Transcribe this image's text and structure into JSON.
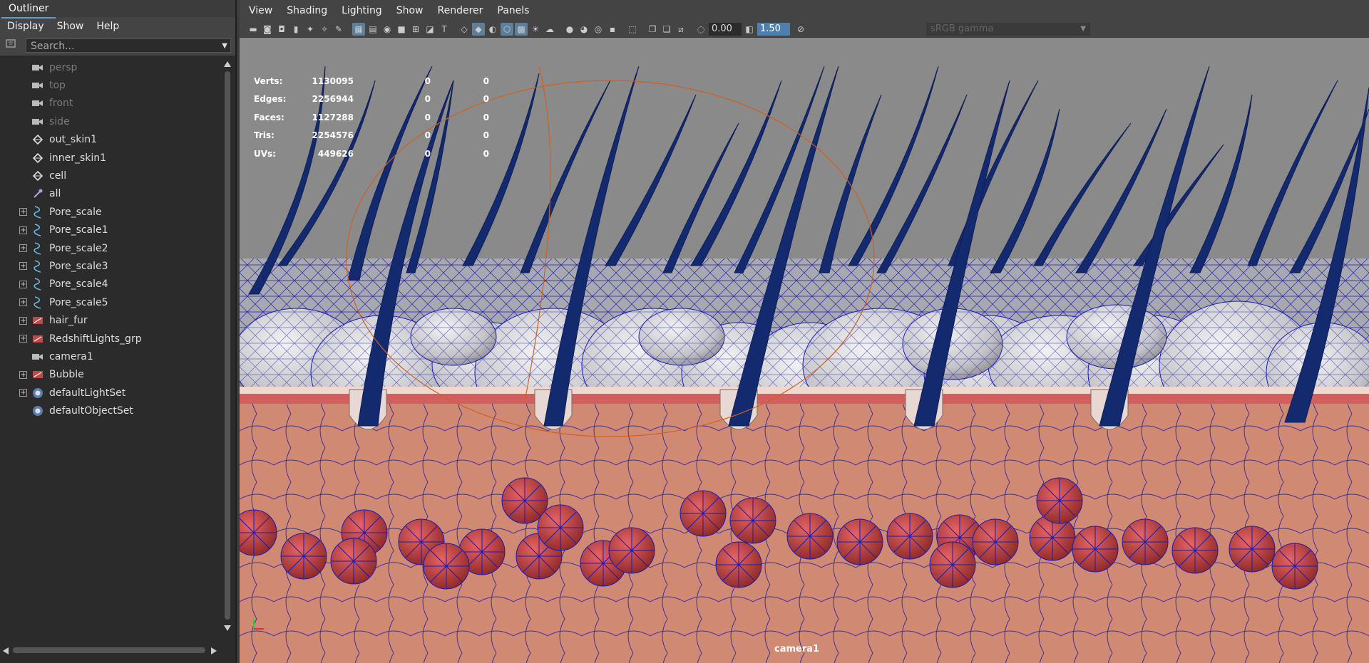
{
  "outliner": {
    "tab_label": "Outliner",
    "menu": [
      "Display",
      "Show",
      "Help"
    ],
    "search_placeholder": "Search...",
    "items": [
      {
        "label": "persp",
        "icon": "camera-icon",
        "dim": true,
        "expand": false
      },
      {
        "label": "top",
        "icon": "camera-icon",
        "dim": true,
        "expand": false
      },
      {
        "label": "front",
        "icon": "camera-icon",
        "dim": true,
        "expand": false
      },
      {
        "label": "side",
        "icon": "camera-icon",
        "dim": true,
        "expand": false
      },
      {
        "label": "out_skin1",
        "icon": "mesh-icon",
        "dim": false,
        "expand": false
      },
      {
        "label": "inner_skin1",
        "icon": "mesh-icon",
        "dim": false,
        "expand": false
      },
      {
        "label": "cell",
        "icon": "mesh-icon",
        "dim": false,
        "expand": false
      },
      {
        "label": "all",
        "icon": "set-icon",
        "dim": false,
        "expand": false
      },
      {
        "label": "Pore_scale",
        "icon": "curve-icon",
        "dim": false,
        "expand": true
      },
      {
        "label": "Pore_scale1",
        "icon": "curve-icon",
        "dim": false,
        "expand": true
      },
      {
        "label": "Pore_scale2",
        "icon": "curve-icon",
        "dim": false,
        "expand": true
      },
      {
        "label": "Pore_scale3",
        "icon": "curve-icon",
        "dim": false,
        "expand": true
      },
      {
        "label": "Pore_scale4",
        "icon": "curve-icon",
        "dim": false,
        "expand": true
      },
      {
        "label": "Pore_scale5",
        "icon": "curve-icon",
        "dim": false,
        "expand": true
      },
      {
        "label": "hair_fur",
        "icon": "group-icon",
        "dim": false,
        "expand": true
      },
      {
        "label": "RedshiftLights_grp",
        "icon": "group-icon",
        "dim": false,
        "expand": true
      },
      {
        "label": "camera1",
        "icon": "camera-icon",
        "dim": false,
        "expand": false
      },
      {
        "label": "Bubble",
        "icon": "group-icon",
        "dim": false,
        "expand": true
      },
      {
        "label": "defaultLightSet",
        "icon": "lightset-icon",
        "dim": false,
        "expand": true
      },
      {
        "label": "defaultObjectSet",
        "icon": "lightset-icon",
        "dim": false,
        "expand": false
      }
    ]
  },
  "viewport": {
    "menu": [
      "View",
      "Shading",
      "Lighting",
      "Show",
      "Renderer",
      "Panels"
    ],
    "exposure": "0.00",
    "gamma": "1.50",
    "color_space": "sRGB gamma",
    "camera_label": "camera1",
    "hud": [
      {
        "label": "Verts:",
        "v1": "1130095",
        "v2": "0",
        "v3": "0"
      },
      {
        "label": "Edges:",
        "v1": "2256944",
        "v2": "0",
        "v3": "0"
      },
      {
        "label": "Faces:",
        "v1": "1127288",
        "v2": "0",
        "v3": "0"
      },
      {
        "label": "Tris:",
        "v1": "2254576",
        "v2": "0",
        "v3": "0"
      },
      {
        "label": "UVs:",
        "v1": "449626",
        "v2": "0",
        "v3": "0"
      }
    ]
  },
  "colors": {
    "hair": "#142a6e",
    "wire": "#1a1ab8",
    "skin": "#d08a74",
    "cells": "#c8c8cc",
    "blood": "#c04040",
    "background": "#8a8a8a"
  }
}
